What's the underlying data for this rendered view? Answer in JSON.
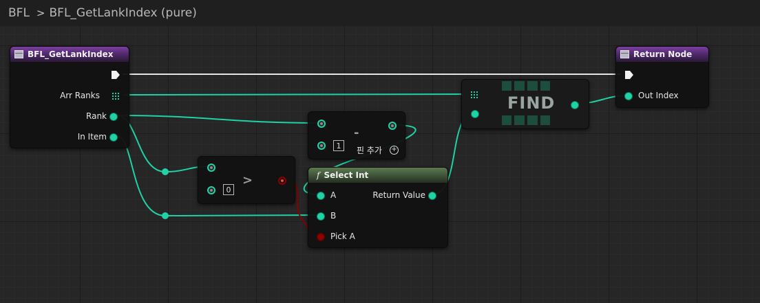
{
  "breadcrumb": {
    "root": "BFL",
    "separator": ">",
    "current": "BFL_GetLankIndex (pure)"
  },
  "nodes": {
    "entry": {
      "title": "BFL_GetLankIndex",
      "pins": [
        "Arr Ranks",
        "Rank",
        "In Item"
      ]
    },
    "return": {
      "title": "Return Node",
      "pins": [
        "Out Index"
      ]
    },
    "find": {
      "title": "FIND"
    },
    "subtract": {
      "symbol": "-",
      "literal": "1",
      "add_pin_label": "핀 추가",
      "add_pin_icon": "+"
    },
    "greater": {
      "symbol": ">",
      "literal": "0"
    },
    "select_int": {
      "title": "Select Int",
      "fn_glyph": "f",
      "pins": {
        "a": "A",
        "b": "B",
        "pick_a": "Pick A",
        "return_value": "Return Value"
      }
    }
  },
  "colors": {
    "int_wire": "#1fd3a6",
    "bool_wire": "#8b0000",
    "exec_wire": "#e6e6e6",
    "pure_header": "#4b2766",
    "select_header": "#3a4d34"
  },
  "icons": {
    "function_icon": "function-icon",
    "array_icon": "array-grid-icon",
    "exec_pin": "exec-arrow-icon",
    "add_pin": "add-circle-icon"
  }
}
